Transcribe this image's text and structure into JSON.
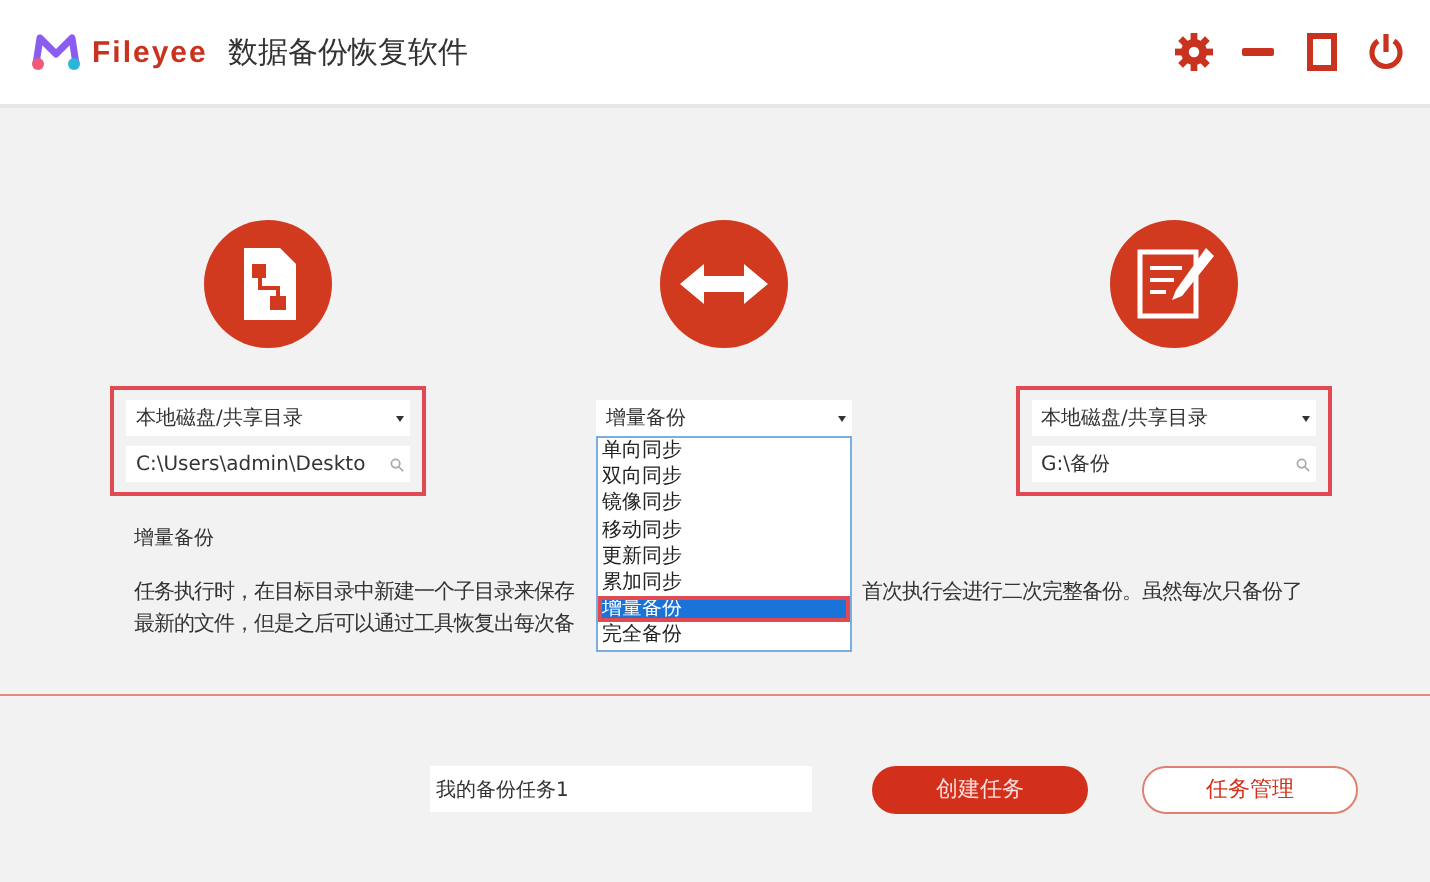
{
  "app": {
    "brand": "Fileyee",
    "title": "数据备份恢复软件"
  },
  "source": {
    "type": "本地磁盘/共享目录",
    "path": "C:\\Users\\admin\\Deskto"
  },
  "mode": {
    "value": "增量备份",
    "options": [
      {
        "label": "单向同步",
        "selected": false
      },
      {
        "label": "双向同步",
        "selected": false
      },
      {
        "label": "镜像同步",
        "selected": false
      },
      {
        "label": "移动同步",
        "selected": false
      },
      {
        "label": "更新同步",
        "selected": false
      },
      {
        "label": "累加同步",
        "selected": false
      },
      {
        "label": "增量备份",
        "selected": true
      },
      {
        "label": "完全备份",
        "selected": false
      }
    ]
  },
  "target": {
    "type": "本地磁盘/共享目录",
    "path": "G:\\备份"
  },
  "description": {
    "title": "增量备份",
    "line_1_left": "任务执行时，在目标目录中新建一个子目录来保存",
    "line_1_right": "首次执行会进行二次完整备份。虽然每次只备份了",
    "line_2_left": "最新的文件，但是之后可以通过工具恢复出每次备"
  },
  "task_name": {
    "value": "我的备份任务1"
  },
  "buttons": {
    "create": "创建任务",
    "manage": "任务管理"
  }
}
